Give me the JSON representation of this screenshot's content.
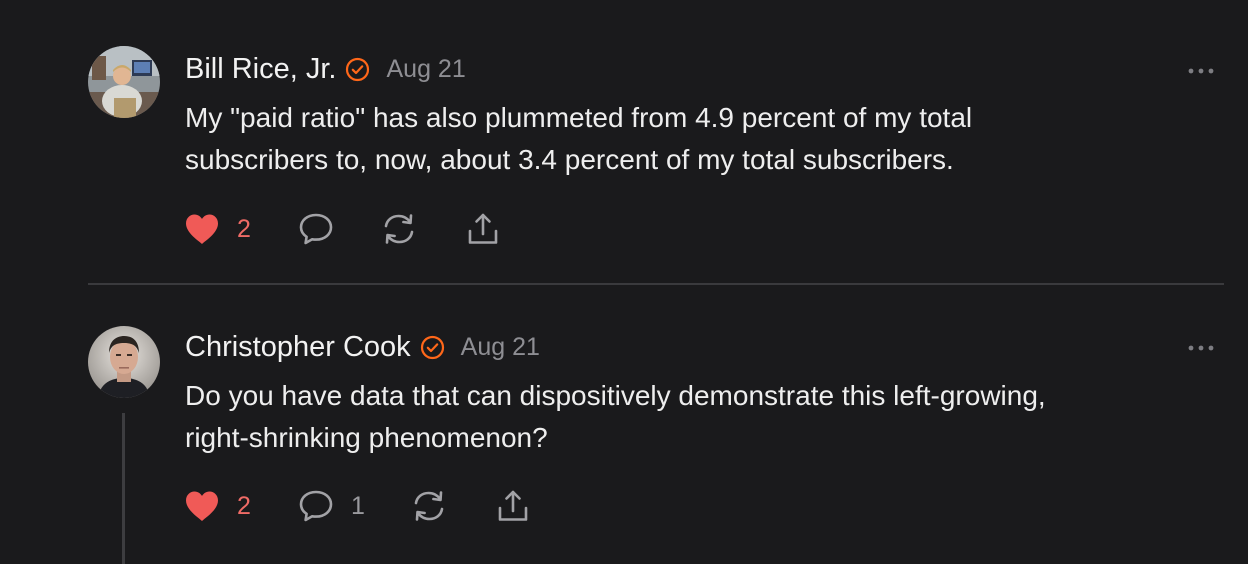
{
  "comments": [
    {
      "author": "Bill Rice, Jr.",
      "date": "Aug 21",
      "text_lines": [
        "My \"paid ratio\" has also plummeted from 4.9 percent of my total",
        "subscribers to, now, about 3.4 percent of my total subscribers."
      ],
      "likes": "2",
      "replies": ""
    },
    {
      "author": "Christopher Cook",
      "date": "Aug 21",
      "text_lines": [
        "Do you have data that can dispositively demonstrate this left-growing,",
        "right-shrinking phenomenon?"
      ],
      "likes": "2",
      "replies": "1"
    }
  ],
  "icons": {
    "verified": "verified-check-icon",
    "like": "heart-icon",
    "reply": "speech-bubble-icon",
    "restack": "restack-arrows-icon",
    "share": "share-upload-icon",
    "more": "more-dots-icon"
  },
  "colors": {
    "background": "#1a1a1c",
    "text": "#eeeeee",
    "muted": "#8e8e93",
    "accent_orange": "#ff6719",
    "like_red": "#f05a57",
    "divider": "#3a3a3d"
  }
}
